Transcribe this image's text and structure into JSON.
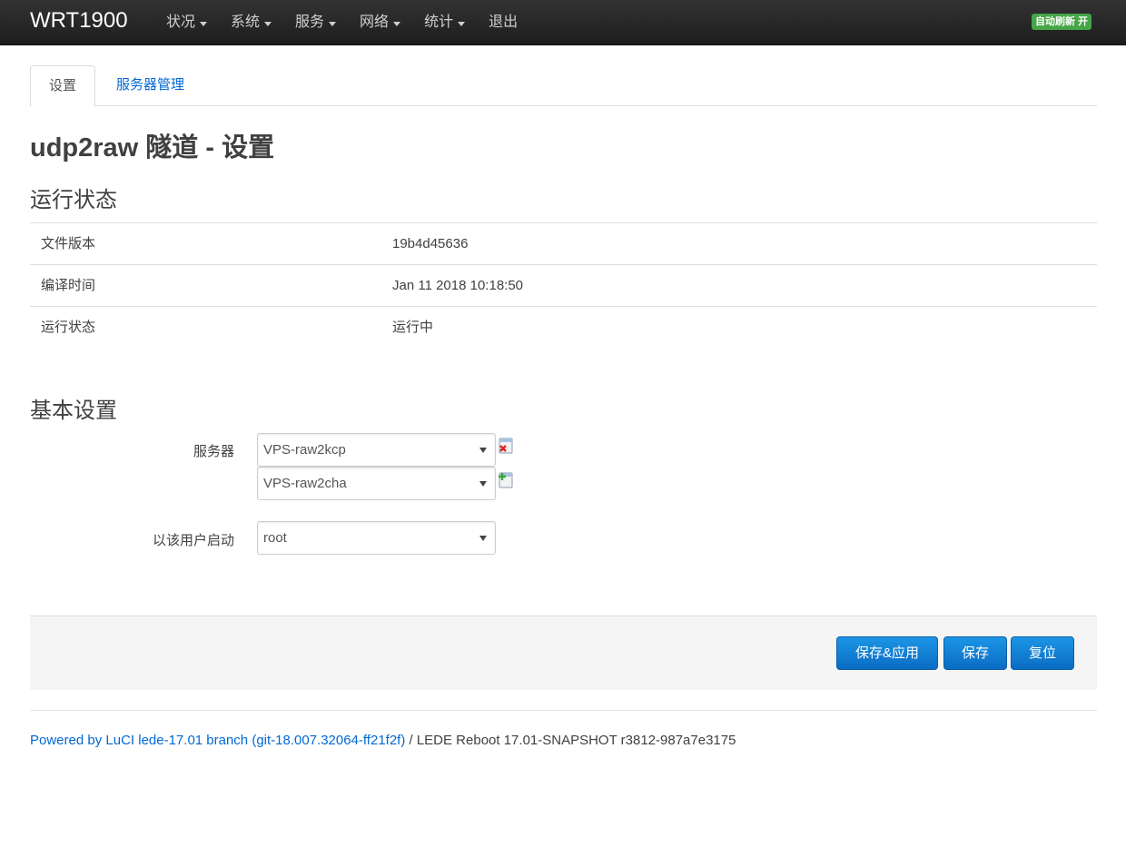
{
  "header": {
    "brand": "WRT1900",
    "menu": [
      "状况",
      "系统",
      "服务",
      "网络",
      "统计",
      "退出"
    ],
    "autorefresh": "自动刷新 开"
  },
  "tabs": [
    "设置",
    "服务器管理"
  ],
  "page_title": "udp2raw 隧道 - 设置",
  "status": {
    "title": "运行状态",
    "rows": [
      {
        "key": "文件版本",
        "value": "19b4d45636"
      },
      {
        "key": "编译时间",
        "value": "Jan 11 2018 10:18:50"
      },
      {
        "key": "运行状态",
        "value": "运行中"
      }
    ]
  },
  "basic": {
    "title": "基本设置",
    "server_label": "服务器",
    "servers": [
      "VPS-raw2kcp",
      "VPS-raw2cha"
    ],
    "user_label": "以该用户启动",
    "user_value": "root"
  },
  "actions": {
    "save_apply": "保存&应用",
    "save": "保存",
    "reset": "复位"
  },
  "footer": {
    "link": "Powered by LuCI lede-17.01 branch (git-18.007.32064-ff21f2f)",
    "text": " / LEDE Reboot 17.01-SNAPSHOT r3812-987a7e3175"
  },
  "colors": {
    "navbar": "#222222",
    "link": "#0069d6",
    "button": "#0a6cc3",
    "badge": "#46a546"
  }
}
